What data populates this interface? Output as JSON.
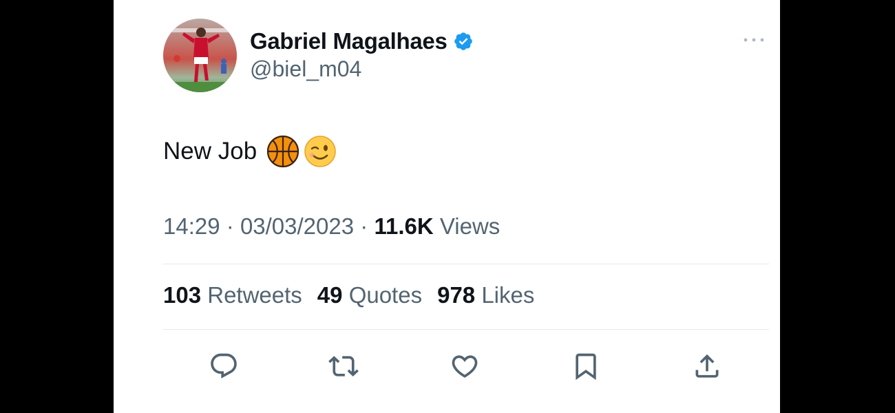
{
  "tweet": {
    "author": {
      "display_name": "Gabriel Magalhaes",
      "handle": "@biel_m04",
      "verified": true
    },
    "text": "New Job",
    "emojis": [
      "basketball-emoji",
      "winking-face-emoji"
    ],
    "time": "14:29",
    "separator": "·",
    "date": "03/03/2023",
    "views_count": "11.6K",
    "views_label": "Views"
  },
  "stats": {
    "retweets_count": "103",
    "retweets_label": "Retweets",
    "quotes_count": "49",
    "quotes_label": "Quotes",
    "likes_count": "978",
    "likes_label": "Likes"
  },
  "actions": [
    {
      "name": "reply",
      "icon": "reply-icon"
    },
    {
      "name": "retweet",
      "icon": "retweet-icon"
    },
    {
      "name": "like",
      "icon": "heart-icon"
    },
    {
      "name": "bookmark",
      "icon": "bookmark-icon"
    },
    {
      "name": "share",
      "icon": "share-icon"
    }
  ],
  "colors": {
    "background_outer": "#000000",
    "card": "#ffffff",
    "primary_text": "#0f1419",
    "secondary_text": "#536471",
    "verified_blue": "#1d9bf0",
    "divider": "#e7e9ea"
  }
}
